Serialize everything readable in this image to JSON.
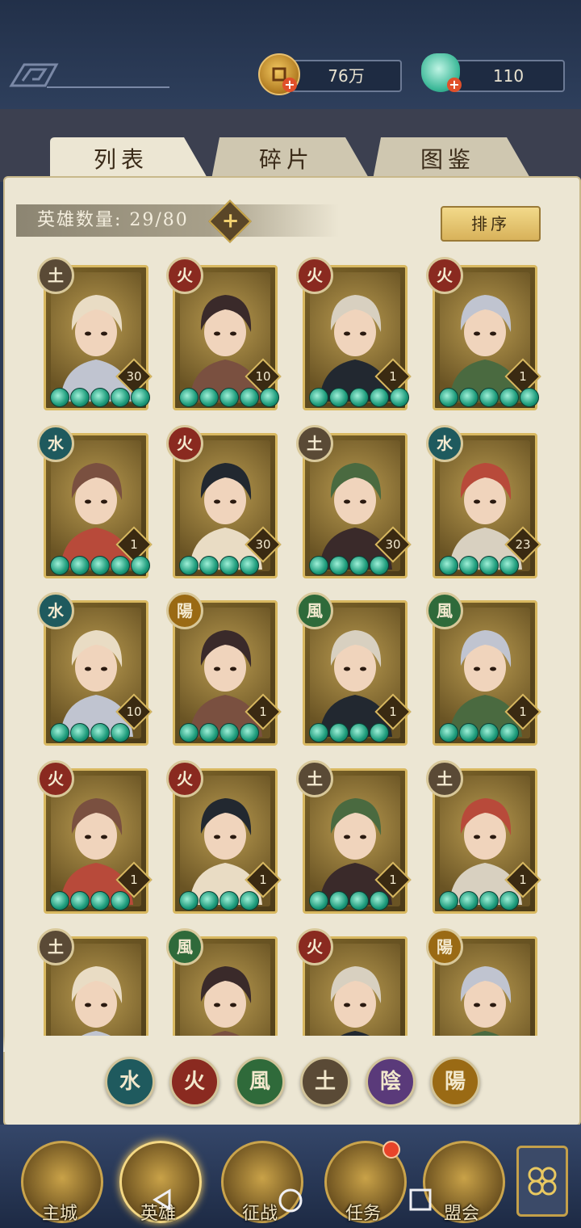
{
  "resources": {
    "coins": "76万",
    "jade": "110",
    "plus": "+"
  },
  "tabs": [
    "列表",
    "碎片",
    "图鉴"
  ],
  "hero_count": {
    "label": "英雄数量: 29/80",
    "plus": "+"
  },
  "sort_button": "排序",
  "element_colors": {
    "water": "#1f5a5e",
    "fire": "#8a2a20",
    "wind": "#2f6a3a",
    "earth": "#5a4a36",
    "yin": "#5a3a7a",
    "yang": "#9a6a14"
  },
  "heroes": [
    {
      "element": "earth",
      "glyph": "土",
      "level": "30",
      "stars": 5
    },
    {
      "element": "fire",
      "glyph": "火",
      "level": "10",
      "stars": 5
    },
    {
      "element": "fire",
      "glyph": "火",
      "level": "1",
      "stars": 5
    },
    {
      "element": "fire",
      "glyph": "火",
      "level": "1",
      "stars": 5
    },
    {
      "element": "water",
      "glyph": "水",
      "level": "1",
      "stars": 5
    },
    {
      "element": "fire",
      "glyph": "火",
      "level": "30",
      "stars": 4
    },
    {
      "element": "earth",
      "glyph": "土",
      "level": "30",
      "stars": 4
    },
    {
      "element": "water",
      "glyph": "水",
      "level": "23",
      "stars": 4
    },
    {
      "element": "water",
      "glyph": "水",
      "level": "10",
      "stars": 4
    },
    {
      "element": "yang",
      "glyph": "陽",
      "level": "1",
      "stars": 4
    },
    {
      "element": "wind",
      "glyph": "風",
      "level": "1",
      "stars": 4
    },
    {
      "element": "wind",
      "glyph": "風",
      "level": "1",
      "stars": 4
    },
    {
      "element": "fire",
      "glyph": "火",
      "level": "1",
      "stars": 4
    },
    {
      "element": "fire",
      "glyph": "火",
      "level": "1",
      "stars": 4
    },
    {
      "element": "earth",
      "glyph": "土",
      "level": "1",
      "stars": 4
    },
    {
      "element": "earth",
      "glyph": "土",
      "level": "1",
      "stars": 4
    },
    {
      "element": "earth",
      "glyph": "土"
    },
    {
      "element": "wind",
      "glyph": "風"
    },
    {
      "element": "fire",
      "glyph": "火"
    },
    {
      "element": "yang",
      "glyph": "陽"
    }
  ],
  "filters": [
    {
      "element": "water",
      "glyph": "水"
    },
    {
      "element": "fire",
      "glyph": "火"
    },
    {
      "element": "wind",
      "glyph": "風"
    },
    {
      "element": "earth",
      "glyph": "土"
    },
    {
      "element": "yin",
      "glyph": "陰"
    },
    {
      "element": "yang",
      "glyph": "陽"
    }
  ],
  "nav": [
    "主城",
    "英雄",
    "征战",
    "任务",
    "盟会"
  ],
  "icons": {
    "coin": "coin-icon",
    "jade": "jade-pouch-icon",
    "menu": "menu-flower-icon",
    "back": "back-triangle-icon",
    "home": "home-circle-icon",
    "recents": "recents-square-icon"
  }
}
